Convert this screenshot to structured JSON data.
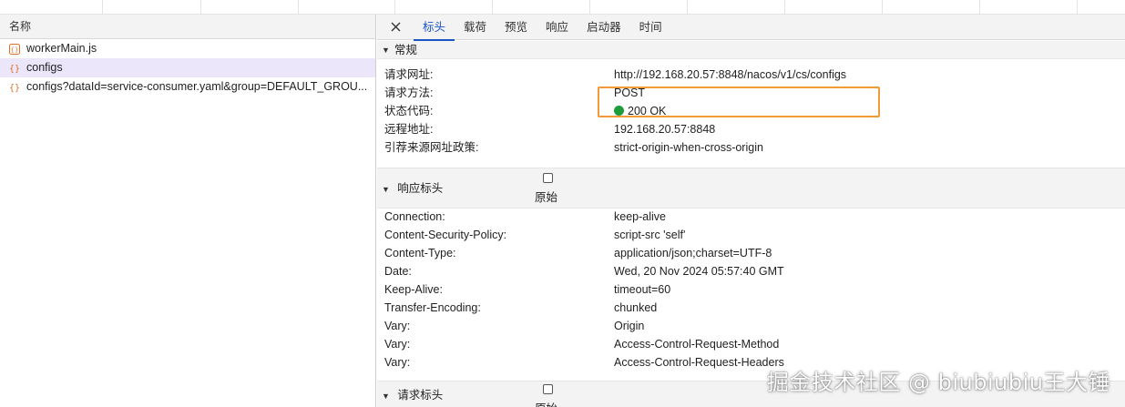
{
  "left_panel": {
    "header": "名称",
    "requests": [
      {
        "label": "workerMain.js",
        "type": "script",
        "selected": false
      },
      {
        "label": "configs",
        "type": "fetch",
        "selected": true
      },
      {
        "label": "configs?dataId=service-consumer.yaml&group=DEFAULT_GROU...",
        "type": "fetch",
        "selected": false
      }
    ]
  },
  "tabs": [
    {
      "label": "标头",
      "active": true
    },
    {
      "label": "载荷",
      "active": false
    },
    {
      "label": "预览",
      "active": false
    },
    {
      "label": "响应",
      "active": false
    },
    {
      "label": "启动器",
      "active": false
    },
    {
      "label": "时间",
      "active": false
    }
  ],
  "general": {
    "title": "常规",
    "rows": [
      {
        "key": "请求网址:",
        "value": "http://192.168.20.57:8848/nacos/v1/cs/configs"
      },
      {
        "key": "请求方法:",
        "value": "POST"
      },
      {
        "key": "状态代码:",
        "value": "200 OK"
      },
      {
        "key": "远程地址:",
        "value": "192.168.20.57:8848"
      },
      {
        "key": "引荐来源网址政策:",
        "value": "strict-origin-when-cross-origin"
      }
    ]
  },
  "response_headers": {
    "title": "响应标头",
    "raw_label": "原始",
    "rows": [
      {
        "key": "Connection:",
        "value": "keep-alive"
      },
      {
        "key": "Content-Security-Policy:",
        "value": "script-src 'self'"
      },
      {
        "key": "Content-Type:",
        "value": "application/json;charset=UTF-8"
      },
      {
        "key": "Date:",
        "value": "Wed, 20 Nov 2024 05:57:40 GMT"
      },
      {
        "key": "Keep-Alive:",
        "value": "timeout=60"
      },
      {
        "key": "Transfer-Encoding:",
        "value": "chunked"
      },
      {
        "key": "Vary:",
        "value": "Origin"
      },
      {
        "key": "Vary:",
        "value": "Access-Control-Request-Method"
      },
      {
        "key": "Vary:",
        "value": "Access-Control-Request-Headers"
      }
    ]
  },
  "request_headers": {
    "title": "请求标头",
    "raw_label": "原始"
  },
  "watermark": "掘金技术社区 @ biubiubiu王大锤",
  "colors": {
    "accent": "#1a56c4",
    "selected_row": "#ece6fb",
    "status_ok": "#1e9c3b",
    "highlight": "#f29a38"
  }
}
